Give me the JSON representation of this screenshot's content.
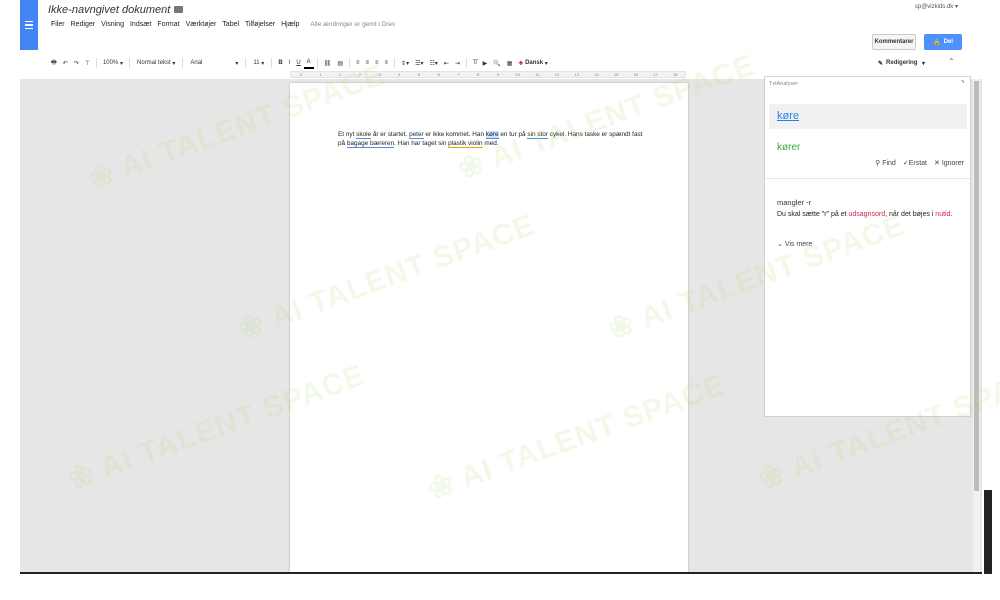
{
  "header": {
    "doc_title": "Ikke-navngivet dokument",
    "user_email": "sp@vizkids.dk",
    "comments_label": "Kommentarer",
    "share_label": "Del",
    "save_status": "Alle ændringer er gemt i Drev"
  },
  "menu": [
    "Filer",
    "Rediger",
    "Visning",
    "Indsæt",
    "Format",
    "Værktøjer",
    "Tabel",
    "Tilføjelser",
    "Hjælp"
  ],
  "toolbar": {
    "zoom": "100%",
    "style": "Normal tekst",
    "font": "Arial",
    "size": "11",
    "bold": "B",
    "italic": "I",
    "underline": "U",
    "text_color": "A",
    "language": "Dansk",
    "mode": "Redigering"
  },
  "ruler_ticks": [
    "2",
    "1",
    "1",
    "2",
    "3",
    "4",
    "5",
    "6",
    "7",
    "8",
    "9",
    "10",
    "11",
    "12",
    "13",
    "14",
    "15",
    "16",
    "17",
    "18"
  ],
  "document": {
    "s1": "Et nyt ",
    "w_skole": "skole",
    "s2": " år er startet. ",
    "w_peter": "peter",
    "s3": " er ikke kommet. Han ",
    "w_kore": "køre",
    "s4": " en tur på ",
    "w_sinstor": "sin stor",
    "s5": " cykel. Hans taske er spændt fast på ",
    "w_bagage": "bagage bæreren",
    "s6": ". Han har taget sin ",
    "w_plastik": "plastik violin",
    "s7": " med."
  },
  "panel": {
    "title": "TxtAnalyser",
    "word": "køre",
    "suggestion": "kører",
    "find": "Find",
    "replace": "Erstat",
    "ignore": "Ignorer",
    "rule_name": "mangler -r",
    "desc_a": "Du skal sætte \"r\" på et ",
    "desc_b": "udsagnsord",
    "desc_c": ", når det bøjes i ",
    "desc_d": "nutid",
    "desc_e": ".",
    "see_more": "Vis mere"
  },
  "colors": {
    "docs_blue": "#4285f4",
    "share_blue": "#4d90fe",
    "link_blue": "#2b7de9",
    "suggestion_green": "#3aa73a",
    "term_red": "#d6234a"
  }
}
